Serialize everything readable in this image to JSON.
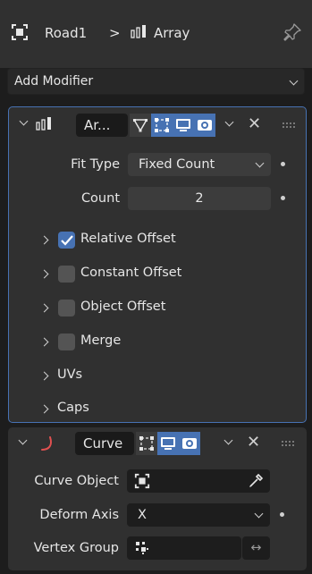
{
  "breadcrumb": {
    "object_name": "Road1",
    "separator": ">",
    "modifier_name": "Array"
  },
  "add_modifier": {
    "label": "Add Modifier"
  },
  "array_modifier": {
    "name": "Ar...",
    "fit_type": {
      "label": "Fit Type",
      "value": "Fixed Count"
    },
    "count": {
      "label": "Count",
      "value": "2"
    },
    "subpanels": [
      {
        "label": "Relative Offset",
        "checked": true
      },
      {
        "label": "Constant Offset",
        "checked": false
      },
      {
        "label": "Object Offset",
        "checked": false
      },
      {
        "label": "Merge",
        "checked": false
      },
      {
        "label": "UVs"
      },
      {
        "label": "Caps"
      }
    ]
  },
  "curve_modifier": {
    "name": "Curve",
    "curve_object": {
      "label": "Curve Object",
      "value": ""
    },
    "deform_axis": {
      "label": "Deform Axis",
      "value": "X"
    },
    "vertex_group": {
      "label": "Vertex Group",
      "value": ""
    }
  },
  "colors": {
    "accent": "#4772b3",
    "panel": "#303030",
    "background": "#1d1d1d",
    "curve_icon": "#e05050"
  }
}
